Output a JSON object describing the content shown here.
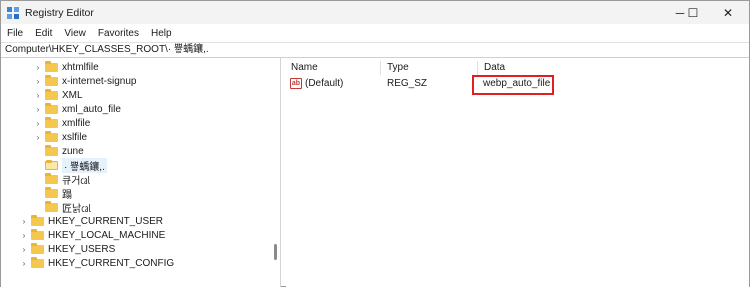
{
  "window": {
    "title": "Registry Editor",
    "controls": {
      "minimize": "─",
      "maximize": "☐",
      "close": "✕"
    }
  },
  "menu": [
    "File",
    "Edit",
    "View",
    "Favorites",
    "Help"
  ],
  "address": "Computer\\HKEY_CLASSES_ROOT\\· 쁗蝺鑲,.",
  "tree": [
    {
      "label": "xhtmlfile",
      "level": 2,
      "expander": "›"
    },
    {
      "label": "x-internet-signup",
      "level": 2,
      "expander": "›"
    },
    {
      "label": "XML",
      "level": 2,
      "expander": "›"
    },
    {
      "label": "xml_auto_file",
      "level": 2,
      "expander": "›"
    },
    {
      "label": "xmlfile",
      "level": 2,
      "expander": "›"
    },
    {
      "label": "xslfile",
      "level": 2,
      "expander": "›"
    },
    {
      "label": "zune",
      "level": 2,
      "expander": ""
    },
    {
      "label": "· 쁗蝺鑲,.",
      "level": 2,
      "expander": "",
      "selected": true
    },
    {
      "label": "큐거㎈",
      "level": 2,
      "expander": ""
    },
    {
      "label": "蹋",
      "level": 2,
      "expander": ""
    },
    {
      "label": "匠낡㎈",
      "level": 2,
      "expander": ""
    },
    {
      "label": "HKEY_CURRENT_USER",
      "level": 1,
      "expander": "›"
    },
    {
      "label": "HKEY_LOCAL_MACHINE",
      "level": 1,
      "expander": "›"
    },
    {
      "label": "HKEY_USERS",
      "level": 1,
      "expander": "›"
    },
    {
      "label": "HKEY_CURRENT_CONFIG",
      "level": 1,
      "expander": "›"
    }
  ],
  "columns": {
    "name": "Name",
    "type": "Type",
    "data": "Data"
  },
  "values": [
    {
      "icon": "ab",
      "name": "(Default)",
      "type": "REG_SZ",
      "data": "webp_auto_file"
    }
  ],
  "colors": {
    "highlight": "#e02020",
    "folder": "#f4c84e",
    "selection": "#e5f1fb"
  }
}
